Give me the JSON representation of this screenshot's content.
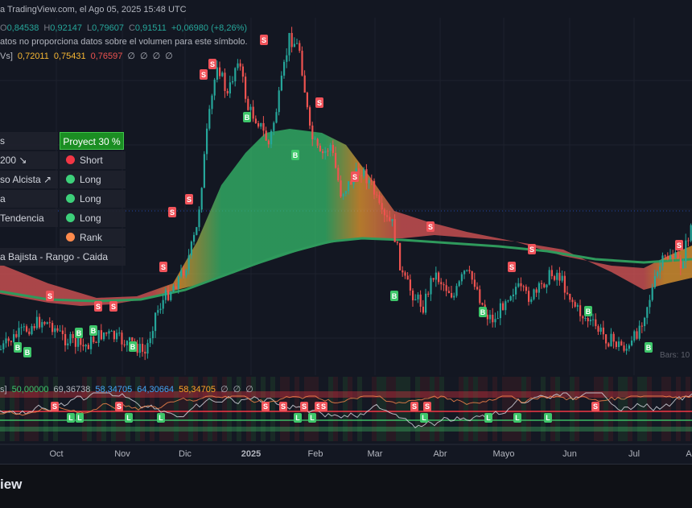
{
  "header": {
    "source": "a TradingView.com, el Ago 05, 2025 15:48 UTC",
    "ohlc": [
      {
        "l": "O",
        "v": "0,84538"
      },
      {
        "l": "H",
        "v": "0,92147"
      },
      {
        "l": "L",
        "v": "0,79607"
      },
      {
        "l": "C",
        "v": "0,91511"
      },
      {
        "l": "",
        "v": "+0,06980 (+8,26%)"
      }
    ],
    "volume_note": "atos no proporciona datos sobre el volumen para este símbolo.",
    "ma_label": "Vs]",
    "ma_values": [
      "0,72011",
      "0,75431",
      "0,76597",
      "∅",
      "∅",
      "∅",
      "∅"
    ],
    "osc_label": "s]",
    "osc_values": [
      "50,00000",
      "69,36738",
      "58,34705",
      "64,30664",
      "58,34705",
      "∅",
      "∅",
      "∅"
    ]
  },
  "panel": {
    "rows": [
      {
        "label": "s",
        "signal": "",
        "color": ""
      },
      {
        "label": "200 ↘",
        "signal": "Short",
        "color": "#f23645"
      },
      {
        "label": "so Alcista ↗",
        "signal": "Long",
        "color": "#3dd07a"
      },
      {
        "label": "a",
        "signal": "Long",
        "color": "#3dd07a"
      },
      {
        "label": "Tendencia",
        "signal": "Long",
        "color": "#3dd07a"
      },
      {
        "label": "",
        "signal": "Rank",
        "color": "#ff8a4c"
      },
      {
        "label": "a Bajista - Rango  - Caida",
        "signal": "",
        "color": ""
      }
    ],
    "projection": "Proyect 30 %"
  },
  "bars_text": "Bars: 10",
  "logo": "iew",
  "colors": {
    "up": "#26a69a",
    "down": "#ef5350",
    "buy": "#3ec66a",
    "sell": "#f0535a",
    "band_bear": "#e45858",
    "band_bull": "#36c26e",
    "band_orange": "#f0a030",
    "ma_line": "#2f9a5c"
  },
  "chart_data": {
    "type": "candlestick",
    "x_ticks": [
      "Oct",
      "Nov",
      "Dic",
      "2025",
      "Feb",
      "Mar",
      "Abr",
      "Mayo",
      "Jun",
      "Jul",
      "A"
    ],
    "close_path": [
      0.4,
      0.44,
      0.47,
      0.5,
      0.52,
      0.5,
      0.45,
      0.43,
      0.41,
      0.44,
      0.47,
      0.45,
      0.43,
      0.42,
      0.38,
      0.55,
      0.62,
      0.68,
      0.75,
      0.9,
      1.3,
      1.6,
      1.45,
      1.62,
      1.4,
      1.35,
      1.25,
      1.45,
      1.7,
      1.65,
      1.3,
      1.2,
      1.25,
      1.05,
      1.1,
      1.15,
      1.08,
      0.95,
      0.92,
      0.7,
      0.63,
      0.58,
      0.72,
      0.67,
      0.62,
      0.72,
      0.68,
      0.55,
      0.52,
      0.62,
      0.66,
      0.62,
      0.63,
      0.7,
      0.72,
      0.64,
      0.56,
      0.52,
      0.48,
      0.44,
      0.42,
      0.4,
      0.5,
      0.62,
      0.75,
      0.8,
      0.75,
      0.92
    ],
    "signals": [
      {
        "t": "S",
        "x": 62,
        "y": 368
      },
      {
        "t": "S",
        "x": 122,
        "y": 381
      },
      {
        "t": "S",
        "x": 141,
        "y": 381
      },
      {
        "t": "B",
        "x": 22,
        "y": 432
      },
      {
        "t": "B",
        "x": 34,
        "y": 438
      },
      {
        "t": "B",
        "x": 98,
        "y": 414
      },
      {
        "t": "B",
        "x": 116,
        "y": 411
      },
      {
        "t": "B",
        "x": 165,
        "y": 431
      },
      {
        "t": "S",
        "x": 203,
        "y": 332
      },
      {
        "t": "S",
        "x": 214,
        "y": 264
      },
      {
        "t": "S",
        "x": 235,
        "y": 248
      },
      {
        "t": "S",
        "x": 253,
        "y": 93
      },
      {
        "t": "S",
        "x": 264,
        "y": 80
      },
      {
        "t": "S",
        "x": 328,
        "y": 50
      },
      {
        "t": "B",
        "x": 307,
        "y": 146
      },
      {
        "t": "B",
        "x": 367,
        "y": 193
      },
      {
        "t": "S",
        "x": 397,
        "y": 128
      },
      {
        "t": "S",
        "x": 441,
        "y": 220
      },
      {
        "t": "B",
        "x": 490,
        "y": 368
      },
      {
        "t": "S",
        "x": 535,
        "y": 282
      },
      {
        "t": "B",
        "x": 600,
        "y": 388
      },
      {
        "t": "S",
        "x": 636,
        "y": 332
      },
      {
        "t": "S",
        "x": 661,
        "y": 310
      },
      {
        "t": "B",
        "x": 731,
        "y": 387
      },
      {
        "t": "B",
        "x": 806,
        "y": 432
      },
      {
        "t": "S",
        "x": 844,
        "y": 305
      }
    ],
    "osc_signals": [
      {
        "t": "S",
        "x": 68
      },
      {
        "t": "L",
        "x": 88
      },
      {
        "t": "L",
        "x": 99
      },
      {
        "t": "S",
        "x": 148
      },
      {
        "t": "L",
        "x": 160
      },
      {
        "t": "L",
        "x": 200
      },
      {
        "t": "S",
        "x": 330
      },
      {
        "t": "S",
        "x": 352
      },
      {
        "t": "L",
        "x": 370
      },
      {
        "t": "S",
        "x": 378
      },
      {
        "t": "L",
        "x": 388
      },
      {
        "t": "S",
        "x": 396
      },
      {
        "t": "S",
        "x": 402
      },
      {
        "t": "S",
        "x": 515
      },
      {
        "t": "L",
        "x": 527
      },
      {
        "t": "S",
        "x": 531
      },
      {
        "t": "L",
        "x": 607
      },
      {
        "t": "L",
        "x": 643
      },
      {
        "t": "L",
        "x": 681
      },
      {
        "t": "S",
        "x": 740
      }
    ]
  }
}
